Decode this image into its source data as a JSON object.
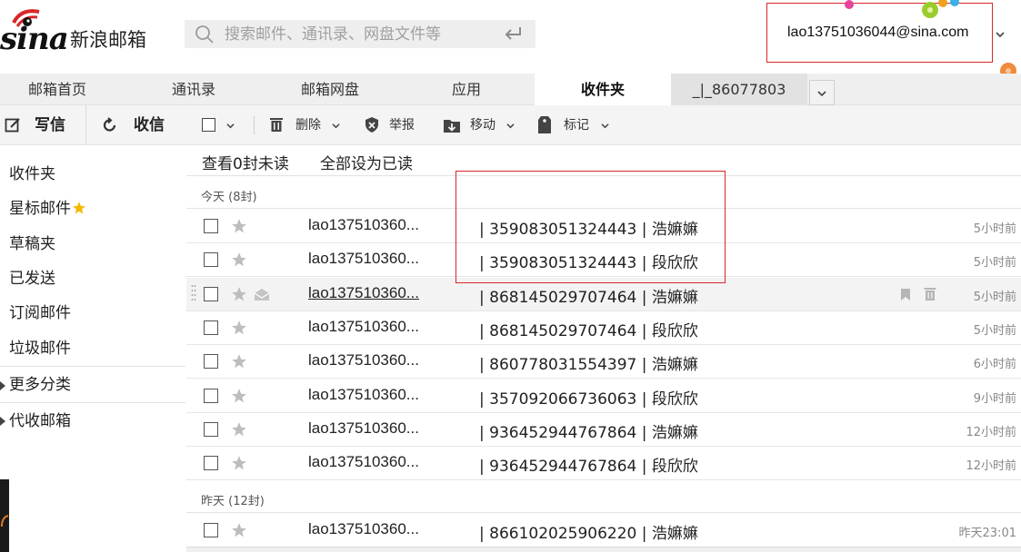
{
  "header": {
    "logo_text": "sina",
    "logo_cn": "新浪邮箱",
    "search_placeholder": "搜索邮件、通讯录、网盘文件等",
    "account_email": "lao13751036044@sina.com"
  },
  "nav": {
    "tabs": [
      {
        "label": "邮箱首页"
      },
      {
        "label": "通讯录"
      },
      {
        "label": "邮箱网盘"
      },
      {
        "label": "应用"
      },
      {
        "label": "收件夹",
        "active": true
      },
      {
        "label": "_|_86077803"
      }
    ]
  },
  "toolbar": {
    "compose_label": "写信",
    "receive_label": "收信",
    "delete_label": "删除",
    "report_label": "举报",
    "move_label": "移动",
    "mark_label": "标记"
  },
  "sidebar": {
    "items": [
      {
        "label": "收件夹"
      },
      {
        "label": "星标邮件"
      },
      {
        "label": "草稿夹"
      },
      {
        "label": "已发送"
      },
      {
        "label": "订阅邮件"
      },
      {
        "label": "垃圾邮件"
      }
    ],
    "more_label": "更多分类",
    "proxy_label": "代收邮箱"
  },
  "list": {
    "view_unread_label": "查看0封未读",
    "mark_all_read_label": "全部设为已读",
    "groups": [
      {
        "title": "今天 (8封)",
        "rows": [
          {
            "sender": "lao137510360...",
            "subject": "| 359083051324443 | 浩嫲嫲",
            "time": "5小时前"
          },
          {
            "sender": "lao137510360...",
            "subject": "| 359083051324443 | 段欣欣",
            "time": "5小时前"
          },
          {
            "sender": "lao137510360...",
            "subject": "| 868145029707464 | 浩嫲嫲",
            "time": "5小时前"
          },
          {
            "sender": "lao137510360...",
            "subject": "| 868145029707464 | 段欣欣",
            "time": "5小时前"
          },
          {
            "sender": "lao137510360...",
            "subject": "| 860778031554397 | 浩嫲嫲",
            "time": "6小时前"
          },
          {
            "sender": "lao137510360...",
            "subject": "| 357092066736063 | 段欣欣",
            "time": "9小时前"
          },
          {
            "sender": "lao137510360...",
            "subject": "| 936452944767864 | 浩嫲嫲",
            "time": "12小时前"
          },
          {
            "sender": "lao137510360...",
            "subject": "| 936452944767864 | 段欣欣",
            "time": "12小时前"
          }
        ]
      },
      {
        "title": "昨天 (12封)",
        "rows": [
          {
            "sender": "lao137510360...",
            "subject": "| 866102025906220 | 浩嫲嫲",
            "time": "昨天23:01"
          }
        ]
      }
    ]
  },
  "colors": {
    "annotation": "#d9262a",
    "star_yellow": "#f5b800",
    "icon_gray": "#bdbdbd"
  }
}
